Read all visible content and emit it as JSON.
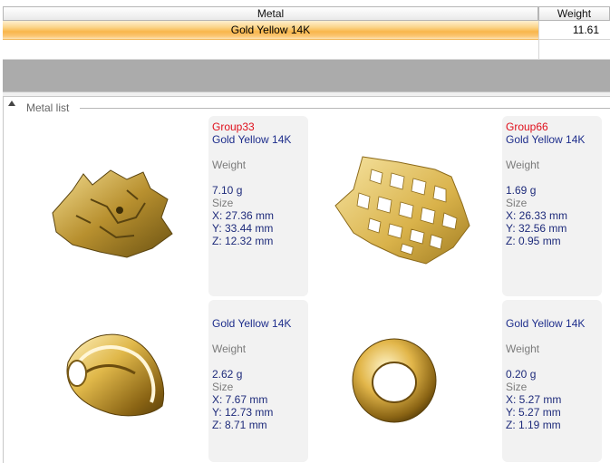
{
  "grid": {
    "columns": [
      "Metal",
      "Weight"
    ],
    "rows": [
      {
        "metal": "Gold Yellow 14K",
        "weight": "11.61"
      }
    ]
  },
  "metal_list": {
    "title": "Metal list",
    "items": [
      {
        "group": "Group33",
        "metal": "Gold Yellow 14K",
        "weight_label": "Weight",
        "weight": "7.10 g",
        "size_label": "Size",
        "x": "X: 27.36 mm",
        "y": "Y: 33.44 mm",
        "z": "Z: 12.32 mm",
        "thumbnail": "wolf-head-pendant"
      },
      {
        "group": "Group66",
        "metal": "Gold Yellow 14K",
        "weight_label": "Weight",
        "weight": "1.69 g",
        "size_label": "Size",
        "x": "X: 26.33 mm",
        "y": "Y: 32.56 mm",
        "z": "Z: 0.95 mm",
        "thumbnail": "geometric-mesh-pendant"
      },
      {
        "group": "",
        "metal": "Gold Yellow 14K",
        "weight_label": "Weight",
        "weight": "2.62 g",
        "size_label": "Size",
        "x": "X: 7.67 mm",
        "y": "Y: 12.73 mm",
        "z": "Z: 8.71 mm",
        "thumbnail": "bail-ring"
      },
      {
        "group": "",
        "metal": "Gold Yellow 14K",
        "weight_label": "Weight",
        "weight": "0.20 g",
        "size_label": "Size",
        "x": "X: 5.27 mm",
        "y": "Y: 5.27 mm",
        "z": "Z: 1.19 mm",
        "thumbnail": "jump-ring"
      }
    ]
  },
  "colors": {
    "gold": "#d9b24a",
    "selection": "#f9b64b",
    "group_red": "#e0101c",
    "metal_blue": "#1e2e8c"
  }
}
